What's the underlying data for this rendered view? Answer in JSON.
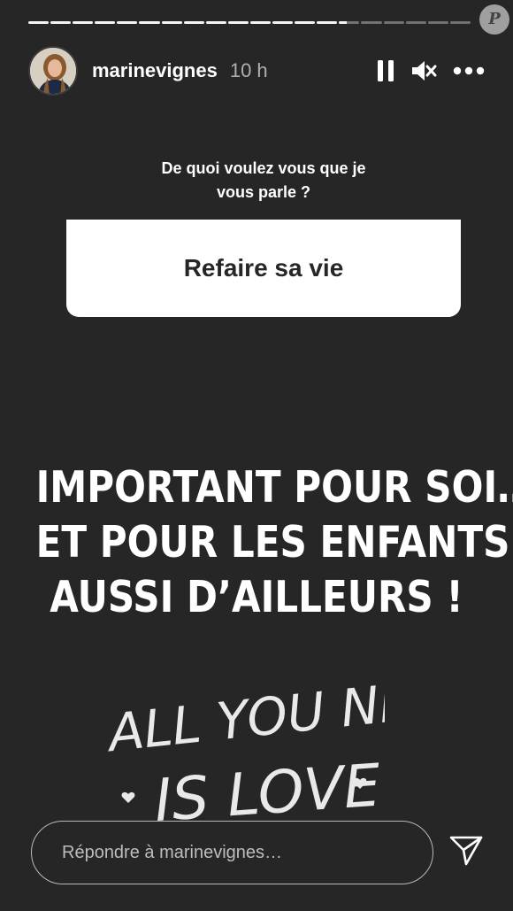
{
  "progress": {
    "segments": 20,
    "active_index": 14
  },
  "watermark": "P",
  "header": {
    "username": "marinevignes",
    "time": "10 h",
    "controls": [
      "pause-icon",
      "muted-speaker-icon",
      "more-icon"
    ]
  },
  "question": {
    "prompt": "De quoi voulez vous que je vous parle ?",
    "answer": "Refaire sa vie"
  },
  "overlay_text": {
    "line1": "IMPORTANT POUR SOI…",
    "line2": "ET POUR LES ENFANTS",
    "line3": "AUSSI D’AILLEURS !"
  },
  "sticker": {
    "line1": "ALL YOU NEED",
    "line2": "IS LOVE"
  },
  "reply": {
    "placeholder": "Répondre à marinevignes…"
  },
  "colors": {
    "background": "#262626",
    "text": "#ffffff",
    "answer_bg": "#ffffff"
  }
}
